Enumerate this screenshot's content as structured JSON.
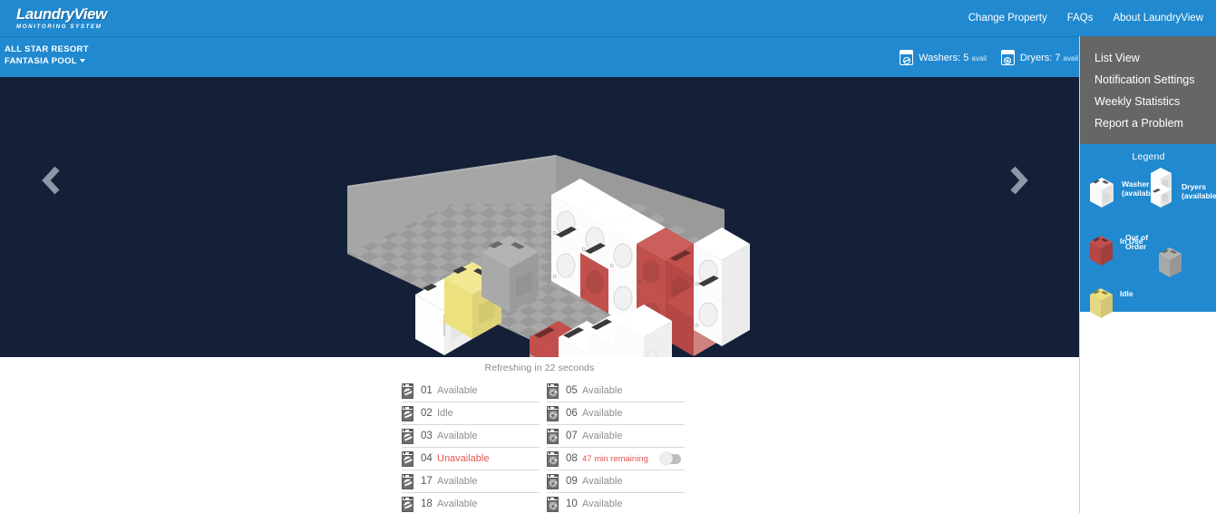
{
  "brand": {
    "name": "LaundryView",
    "tagline": "MONITORING SYSTEM"
  },
  "topnav": {
    "links": [
      {
        "label": "Change Property"
      },
      {
        "label": "FAQs"
      },
      {
        "label": "About LaundryView"
      }
    ]
  },
  "subheader": {
    "property_line1": "ALL STAR RESORT",
    "property_line2": "FANTASIA POOL",
    "counts": [
      {
        "icon": "washer-icon",
        "label": "Washers:",
        "value": "5",
        "unit": "avail"
      },
      {
        "icon": "dryer-icon",
        "label": "Dryers:",
        "value": "7",
        "unit": "avail"
      }
    ]
  },
  "sidebar": {
    "menu": [
      {
        "label": "List View"
      },
      {
        "label": "Notification Settings"
      },
      {
        "label": "Weekly Statistics"
      },
      {
        "label": "Report a Problem"
      }
    ],
    "legend": {
      "title": "Legend",
      "items": [
        {
          "label": "Washer\n(available)",
          "color": "#f2f2f2",
          "icon": "washer-available-icon"
        },
        {
          "label": "Dryers\n(available)",
          "color": "#f2f2f2",
          "icon": "dryer-available-icon"
        },
        {
          "label": "In Use",
          "color": "#c0504d",
          "icon": "machine-inuse-icon"
        },
        {
          "label": "Out of\nOrder",
          "color": "#a3a3a3",
          "icon": "machine-outoforder-icon"
        },
        {
          "label": "Idle",
          "color": "#e8dc8f",
          "icon": "machine-idle-icon"
        }
      ]
    }
  },
  "stage": {
    "prev_label": "Previous room",
    "next_label": "Next room",
    "background": "#132038"
  },
  "status": {
    "refreshing": "Refreshing in 22 seconds"
  },
  "machines": {
    "left_column": [
      {
        "id": "01",
        "type": "washer",
        "status": "Available",
        "state": "available"
      },
      {
        "id": "02",
        "type": "washer",
        "status": "Idle",
        "state": "idle"
      },
      {
        "id": "03",
        "type": "washer",
        "status": "Available",
        "state": "available"
      },
      {
        "id": "04",
        "type": "washer",
        "status": "Unavailable",
        "state": "unavailable"
      },
      {
        "id": "17",
        "type": "washer",
        "status": "Available",
        "state": "available"
      },
      {
        "id": "18",
        "type": "washer",
        "status": "Available",
        "state": "available"
      }
    ],
    "right_column": [
      {
        "id": "05",
        "type": "dryer",
        "status": "Available",
        "state": "available"
      },
      {
        "id": "06",
        "type": "dryer",
        "status": "Available",
        "state": "available"
      },
      {
        "id": "07",
        "type": "dryer",
        "status": "Available",
        "state": "available"
      },
      {
        "id": "08",
        "type": "dryer",
        "status": "47 min remaining",
        "state": "running",
        "toggle": "off"
      },
      {
        "id": "09",
        "type": "dryer",
        "status": "Available",
        "state": "available"
      },
      {
        "id": "10",
        "type": "dryer",
        "status": "Available",
        "state": "available"
      }
    ]
  },
  "colors": {
    "brand_blue": "#2089cf",
    "stage_navy": "#132038",
    "menu_gray": "#666666",
    "in_use_red": "#c0504d",
    "idle_yellow": "#e8dc8f",
    "out_of_order_gray": "#a3a3a3",
    "alert_text": "#e0564f"
  }
}
